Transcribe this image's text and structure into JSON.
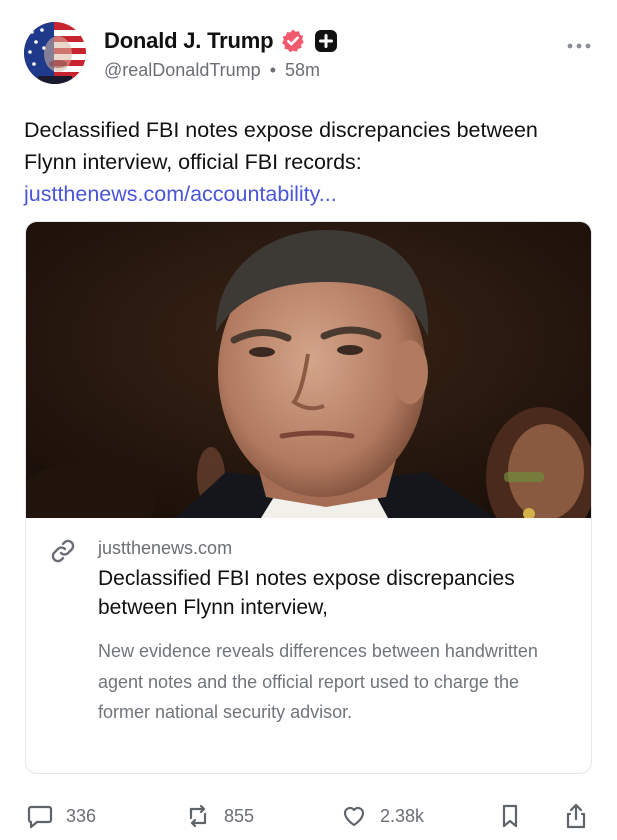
{
  "author": {
    "display_name": "Donald J. Trump",
    "handle": "@realDonaldTrump",
    "separator": "•",
    "time_ago": "58m"
  },
  "post": {
    "text": "Declassified FBI notes expose discrepancies between Flynn interview, official FBI records:",
    "link_text": "justthenews.com/accountability..."
  },
  "card": {
    "domain": "justthenews.com",
    "title": "Declassified FBI notes expose discrepancies between Flynn interview,",
    "description": "New evidence reveals differences between handwritten agent notes and the official report used to charge the former national security advisor."
  },
  "actions": {
    "replies": "336",
    "reposts": "855",
    "likes": "2.38k"
  },
  "colors": {
    "link": "#4a55d8",
    "verified_badge": "#ef5a6d",
    "muted_text": "#6b6f75",
    "card_border": "#e4e6ea"
  },
  "icons": [
    "avatar-image",
    "verified-icon",
    "plus-badge-icon",
    "more-icon",
    "link-icon",
    "reply-icon",
    "repost-icon",
    "like-icon",
    "bookmark-icon",
    "share-icon"
  ]
}
